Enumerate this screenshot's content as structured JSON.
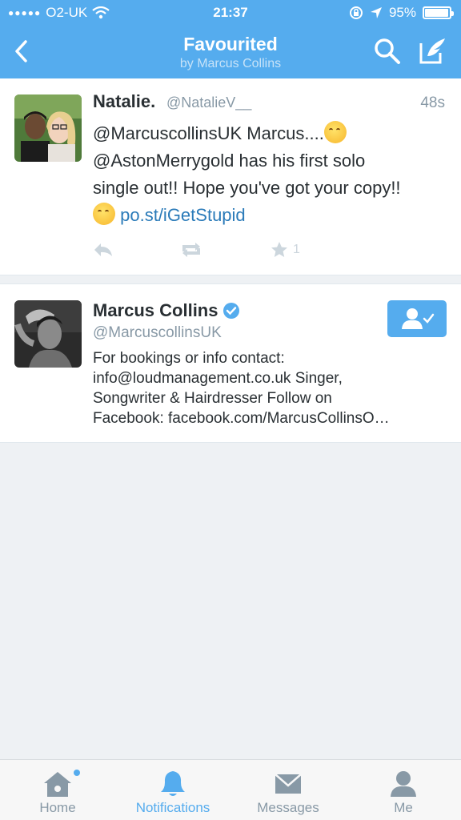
{
  "status_bar": {
    "signal_dots": "●●●●●",
    "carrier": "O2-UK",
    "time": "21:37",
    "battery_percent": "95%",
    "battery_level": 0.95
  },
  "nav": {
    "title": "Favourited",
    "subtitle": "by Marcus Collins"
  },
  "tweet": {
    "name": "Natalie.",
    "handle": "@NatalieV__",
    "time": "48s",
    "text_line1": "@MarcuscollinsUK Marcus....",
    "text_line2": "@AstonMerrygold has his first solo",
    "text_line3": "single out!! Hope you've got your copy!!",
    "link": "po.st/iGetStupid",
    "favorite_count": "1"
  },
  "user": {
    "name": "Marcus Collins",
    "handle": "@MarcuscollinsUK",
    "bio_line1": "For bookings or info contact:",
    "bio_line2": "info@loudmanagement.co.uk Singer,",
    "bio_line3": "Songwriter & Hairdresser Follow on",
    "bio_line4": "Facebook: facebook.com/MarcusCollinsO…"
  },
  "tabs": [
    {
      "label": "Home",
      "icon": "home-icon"
    },
    {
      "label": "Notifications",
      "icon": "bell-icon"
    },
    {
      "label": "Messages",
      "icon": "envelope-icon"
    },
    {
      "label": "Me",
      "icon": "person-icon"
    }
  ],
  "colors": {
    "accent": "#55acee",
    "link": "#2b7bb9",
    "muted": "#8899a6"
  }
}
